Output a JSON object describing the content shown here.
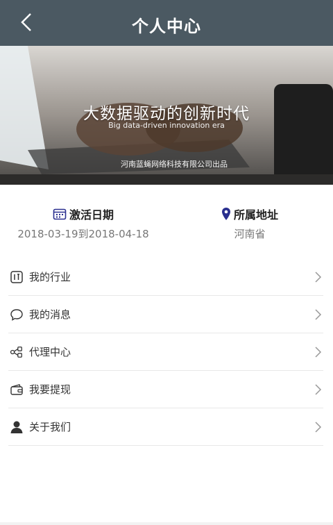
{
  "header": {
    "title": "个人中心"
  },
  "banner": {
    "title": "大数据驱动的创新时代",
    "subtitle": "Big data-driven innovation era",
    "company": "河南蓝蝇网络科技有限公司出品"
  },
  "info": {
    "activation": {
      "label": "激活日期",
      "value": "2018-03-19到2018-04-18",
      "icon": "calendar-icon"
    },
    "location": {
      "label": "所属地址",
      "value": "河南省",
      "icon": "location-pin-icon"
    }
  },
  "menu": {
    "items": [
      {
        "label": "我的行业",
        "icon": "industry-icon"
      },
      {
        "label": "我的消息",
        "icon": "message-icon"
      },
      {
        "label": "代理中心",
        "icon": "agent-icon"
      },
      {
        "label": "我要提现",
        "icon": "wallet-icon"
      },
      {
        "label": "关于我们",
        "icon": "user-icon"
      }
    ]
  },
  "colors": {
    "header_bg": "#4b5962",
    "accent_icon": "#2a2f8f",
    "divider": "#e8e8e8"
  }
}
